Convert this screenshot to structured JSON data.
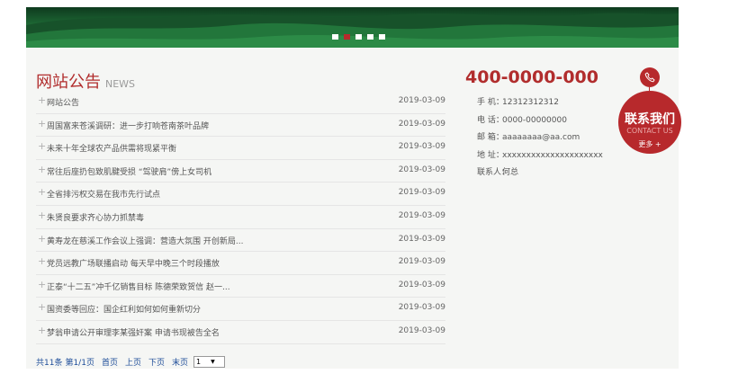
{
  "banner": {
    "slide_count": 5,
    "active_slide": 2
  },
  "news": {
    "title": "网站公告",
    "subtitle": "NEWS",
    "items": [
      {
        "title": "网站公告",
        "date": "2019-03-09"
      },
      {
        "title": "周国富来苍溪调研：进一步打响苍南茶叶品牌",
        "date": "2019-03-09"
      },
      {
        "title": "未来十年全球农产品供需将现紧平衡",
        "date": "2019-03-09"
      },
      {
        "title": "常往后座扔包致肌腱受损 “驾驶肩”傍上女司机",
        "date": "2019-03-09"
      },
      {
        "title": "全省排污权交易在我市先行试点",
        "date": "2019-03-09"
      },
      {
        "title": "朱贤良要求齐心协力抓禁毒",
        "date": "2019-03-09"
      },
      {
        "title": "黄寿龙在慈溪工作会议上强调：营造大氛围 开创新局...",
        "date": "2019-03-09"
      },
      {
        "title": "党员远教广场联播启动 每天早中晚三个时段播放",
        "date": "2019-03-09"
      },
      {
        "title": "正泰“十二五”冲千亿销售目标 陈德荣致贺信 赵一...",
        "date": "2019-03-09"
      },
      {
        "title": "国资委等回应：国企红利如何如何重新切分",
        "date": "2019-03-09"
      },
      {
        "title": "梦翁申请公开审理李某强奸案 申请书现被告全名",
        "date": "2019-03-09"
      }
    ]
  },
  "pager": {
    "total": "共11条",
    "page_info": "第1/1页",
    "first": "首页",
    "prev": "上页",
    "next": "下页",
    "last": "末页",
    "selected_page": "1"
  },
  "contact": {
    "phone": "400-0000-000",
    "rows": [
      {
        "label": "手  机：",
        "value": "12312312312"
      },
      {
        "label": "电  话：",
        "value": "0000-00000000"
      },
      {
        "label": "邮  箱：",
        "value": "aaaaaaaa@aa.com"
      },
      {
        "label": "地  址：",
        "value": "xxxxxxxxxxxxxxxxxxxxx"
      },
      {
        "label": "联系人：",
        "value": "何总"
      }
    ],
    "badge": {
      "cn": "联系我们",
      "en": "CONTACT US",
      "more": "更多 +"
    }
  },
  "colors": {
    "accent": "#b7292c",
    "link": "#1e4d99",
    "banner_green": "#2b8446"
  }
}
